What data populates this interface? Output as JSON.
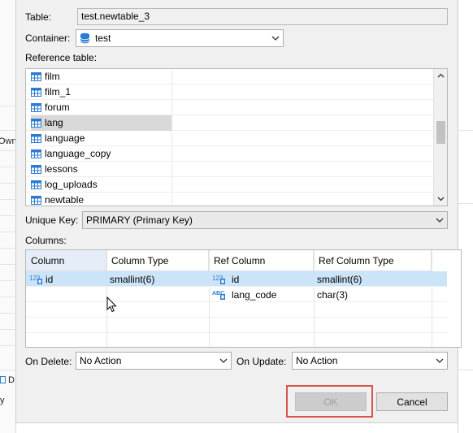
{
  "background": {
    "left_text": "Own",
    "bottom_left_text": "D",
    "bottom_left_text2": "y"
  },
  "dialog": {
    "table_label": "Table:",
    "table_value": "test.newtable_3",
    "container_label": "Container:",
    "container_value": "test",
    "reference_table_label": "Reference table:",
    "reference_tables": [
      {
        "name": "film",
        "selected": false
      },
      {
        "name": "film_1",
        "selected": false
      },
      {
        "name": "forum",
        "selected": false
      },
      {
        "name": "lang",
        "selected": true
      },
      {
        "name": "language",
        "selected": false
      },
      {
        "name": "language_copy",
        "selected": false
      },
      {
        "name": "lessons",
        "selected": false
      },
      {
        "name": "log_uploads",
        "selected": false
      },
      {
        "name": "newtable",
        "selected": false
      }
    ],
    "unique_key_label": "Unique Key:",
    "unique_key_value": "PRIMARY (Primary Key)",
    "columns_label": "Columns:",
    "columns_headers": [
      "Column",
      "Column Type",
      "Ref Column",
      "Ref Column Type"
    ],
    "columns_rows": [
      {
        "column": "id",
        "column_type": "smallint(6)",
        "ref_column": "id",
        "ref_column_type": "smallint(6)",
        "ref_icon": "numeric-icon",
        "col_icon": "numeric-icon",
        "selected": true
      },
      {
        "column": "",
        "column_type": "",
        "ref_column": "lang_code",
        "ref_column_type": "char(3)",
        "ref_icon": "text-icon",
        "col_icon": "",
        "selected": false
      }
    ],
    "on_delete_label": "On Delete:",
    "on_delete_value": "No Action",
    "on_update_label": "On Update:",
    "on_update_value": "No Action",
    "ok_label": "OK",
    "cancel_label": "Cancel"
  },
  "colors": {
    "selection_blue": "#cce4f7",
    "selection_grey": "#d9d9d9",
    "highlight_red": "#d9534f",
    "table_icon_blue": "#2a7bd4"
  }
}
